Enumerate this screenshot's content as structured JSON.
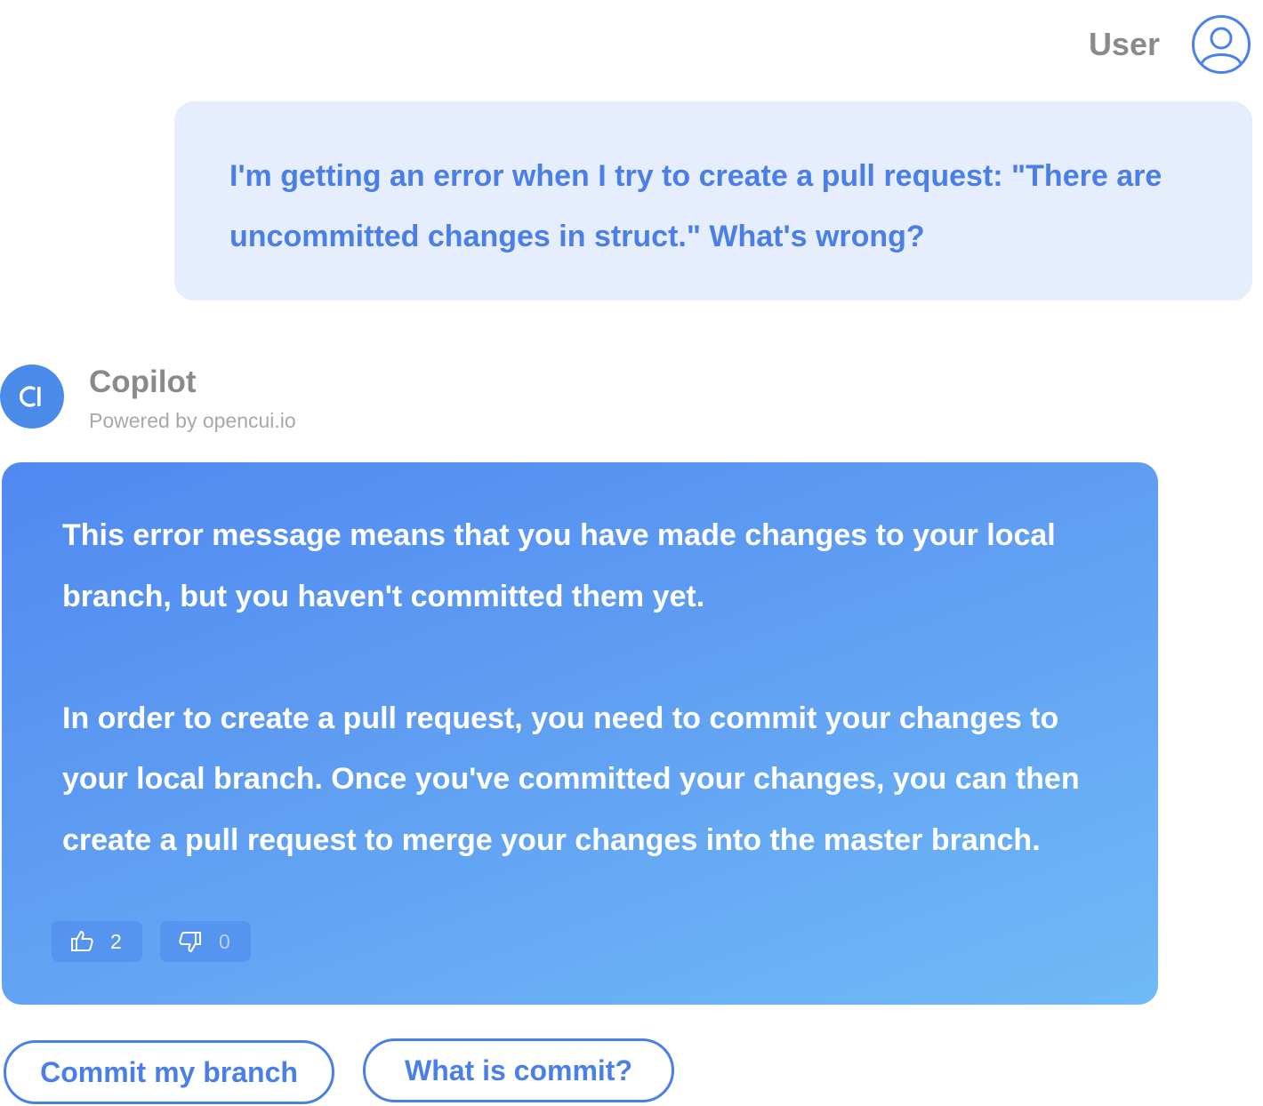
{
  "user": {
    "name": "User",
    "message": "I'm getting an error when I try to create a pull request: \"There are uncommitted changes in struct.\" What's wrong?"
  },
  "bot": {
    "name": "Copilot",
    "powered_by": "Powered by opencui.io",
    "message": "This error message means that you have made changes to your local branch, but you haven't committed them yet.\n\nIn order to create a pull request, you need to commit your changes to your local branch. Once you've committed your changes, you can then create a pull request to merge your changes into the master branch.",
    "thumbs_up_count": "2",
    "thumbs_down_count": "0"
  },
  "suggestions": {
    "first": "Commit my branch",
    "second": "What is commit?"
  },
  "colors": {
    "accent": "#4a7fe8",
    "user_bubble_bg": "#e6edfc",
    "bot_gradient_start": "#5089f1",
    "bot_gradient_end": "#6fbaf7",
    "muted_text": "#8a8a8a"
  },
  "icons": {
    "user_avatar": "user-icon",
    "bot_avatar": "copilot-logo-icon",
    "thumbs_up": "thumbs-up-icon",
    "thumbs_down": "thumbs-down-icon"
  }
}
